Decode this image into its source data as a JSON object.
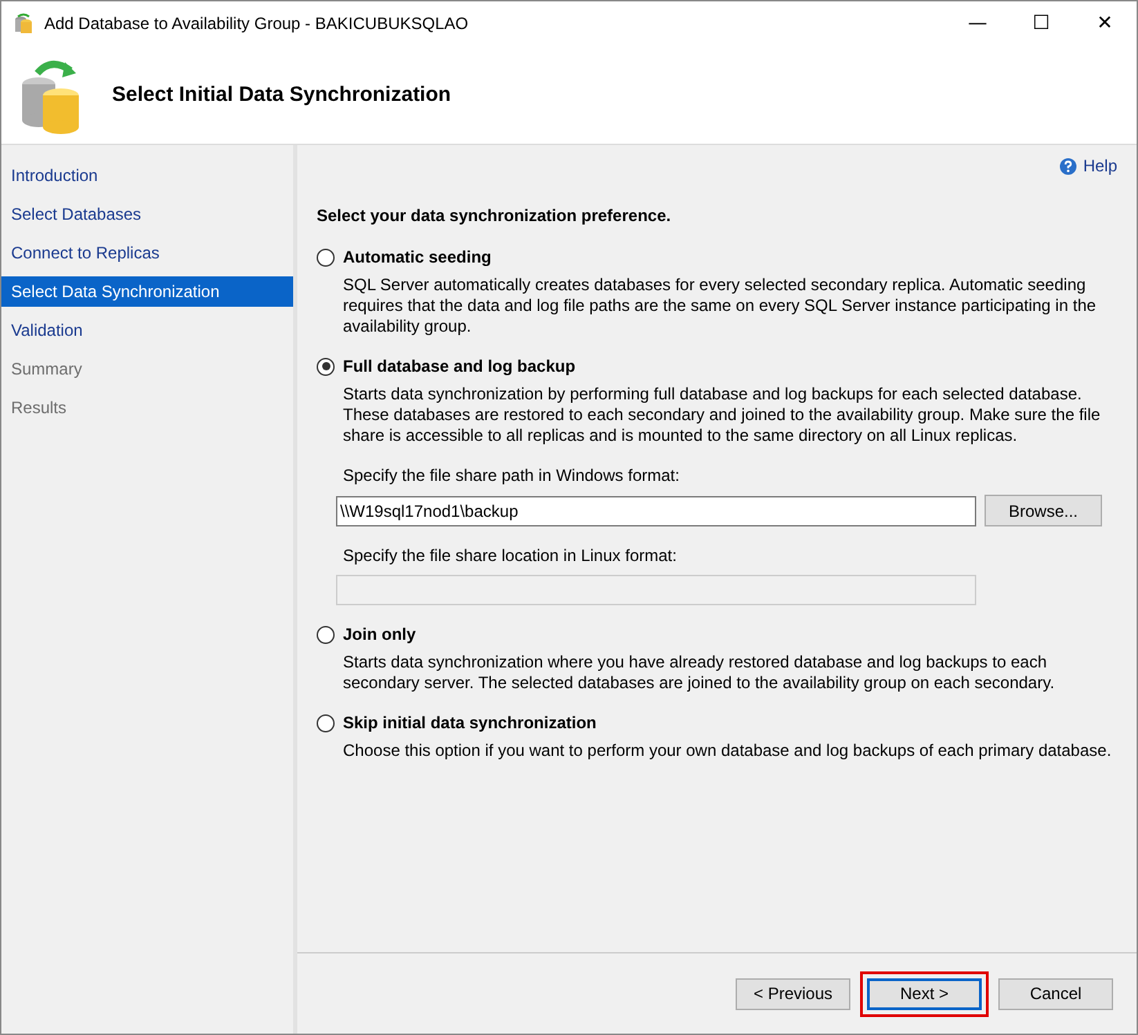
{
  "window": {
    "title": "Add Database to Availability Group - BAKICUBUKSQLAO",
    "controls": [
      "—",
      "☐",
      "✕"
    ]
  },
  "header": {
    "title": "Select Initial Data Synchronization"
  },
  "sidebar": {
    "items": [
      {
        "label": "Introduction",
        "selected": false,
        "disabled": false
      },
      {
        "label": "Select Databases",
        "selected": false,
        "disabled": false
      },
      {
        "label": "Connect to Replicas",
        "selected": false,
        "disabled": false
      },
      {
        "label": "Select Data Synchronization",
        "selected": true,
        "disabled": false
      },
      {
        "label": "Validation",
        "selected": false,
        "disabled": false
      },
      {
        "label": "Summary",
        "selected": false,
        "disabled": true
      },
      {
        "label": "Results",
        "selected": false,
        "disabled": true
      }
    ]
  },
  "help": {
    "label": "Help"
  },
  "prompt": "Select your data synchronization preference.",
  "options": [
    {
      "label": "Automatic seeding",
      "selected": false,
      "description": "SQL Server automatically creates databases for every selected secondary replica. Automatic seeding requires that the data and log file paths are the same on every SQL Server instance participating in the availability group."
    },
    {
      "label": "Full database and log backup",
      "selected": true,
      "description": "Starts data synchronization by performing full database and log backups for each selected database. These databases are restored to each secondary and joined to the availability group. Make sure the file share is accessible to all replicas and is mounted to the same directory on all Linux replicas.",
      "fields": [
        {
          "label": "Specify the file share path in Windows format:",
          "value": "\\\\W19sql17nod1\\backup",
          "disabled": false,
          "button": "Browse..."
        },
        {
          "label": "Specify the file share location in Linux format:",
          "disabled": true
        }
      ]
    },
    {
      "label": "Join only",
      "selected": false,
      "description": "Starts data synchronization where you have already restored database and log backups to each secondary server. The selected databases are joined to the availability group on each secondary."
    },
    {
      "label": "Skip initial data synchronization",
      "selected": false,
      "description": "Choose this option if you want to perform your own database and log backups of each primary database."
    }
  ],
  "buttons": [
    {
      "label": "< Previous",
      "default": false,
      "highlighted": false
    },
    {
      "label": "Next >",
      "default": true,
      "highlighted": true
    },
    {
      "label": "Cancel",
      "default": false,
      "highlighted": false
    }
  ]
}
